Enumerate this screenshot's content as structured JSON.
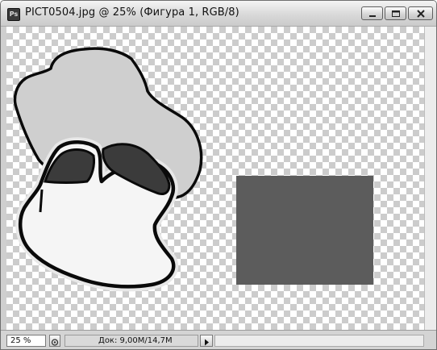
{
  "window": {
    "title": "PICT0504.jpg @ 25% (Фигура 1, RGB/8)",
    "app_icon_label": "Ps"
  },
  "canvas": {
    "background": "transparent-checkerboard",
    "rectangle_color": "#5c5c5c",
    "top_blob_color": "#cfcfcf",
    "bottom_blob_color": "#f5f5f5",
    "dark_patch_color": "#3b3b3b",
    "outline_color": "#0a0a0a"
  },
  "status": {
    "zoom": "25 %",
    "doc_info": "Док: 9,00M/14,7M"
  },
  "icons": {
    "app": "photoshop-icon",
    "minimize": "minimize-icon",
    "maximize": "maximize-icon",
    "close": "close-icon",
    "navigator": "navigator-icon",
    "info_menu": "play-arrow-icon"
  }
}
